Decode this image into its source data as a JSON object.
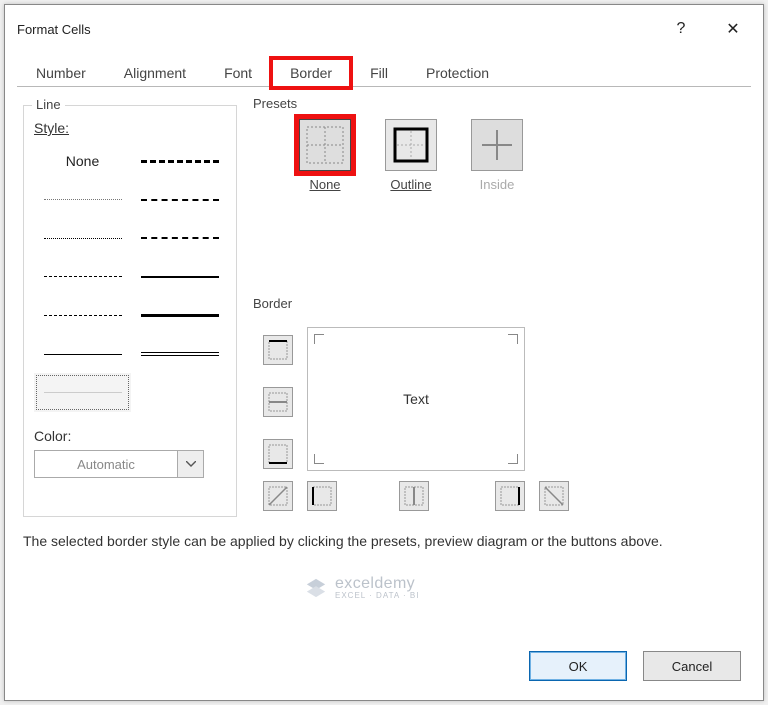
{
  "title": "Format Cells",
  "helpTooltip": "?",
  "closeTooltip": "✕",
  "tabs": {
    "number": "Number",
    "alignment": "Alignment",
    "font": "Font",
    "border": "Border",
    "fill": "Fill",
    "protection": "Protection"
  },
  "line": {
    "legend": "Line",
    "styleLabel": "Style:",
    "noneLabel": "None",
    "colorLabel": "Color:",
    "colorValue": "Automatic"
  },
  "presets": {
    "legend": "Presets",
    "none": "None",
    "outline": "Outline",
    "inside": "Inside"
  },
  "borderSection": {
    "legend": "Border",
    "previewText": "Text"
  },
  "help": "The selected border style can be applied by clicking the presets, preview diagram or the buttons above.",
  "footer": {
    "ok": "OK",
    "cancel": "Cancel"
  },
  "watermark": {
    "name": "exceldemy",
    "tagline": "EXCEL · DATA · BI"
  }
}
